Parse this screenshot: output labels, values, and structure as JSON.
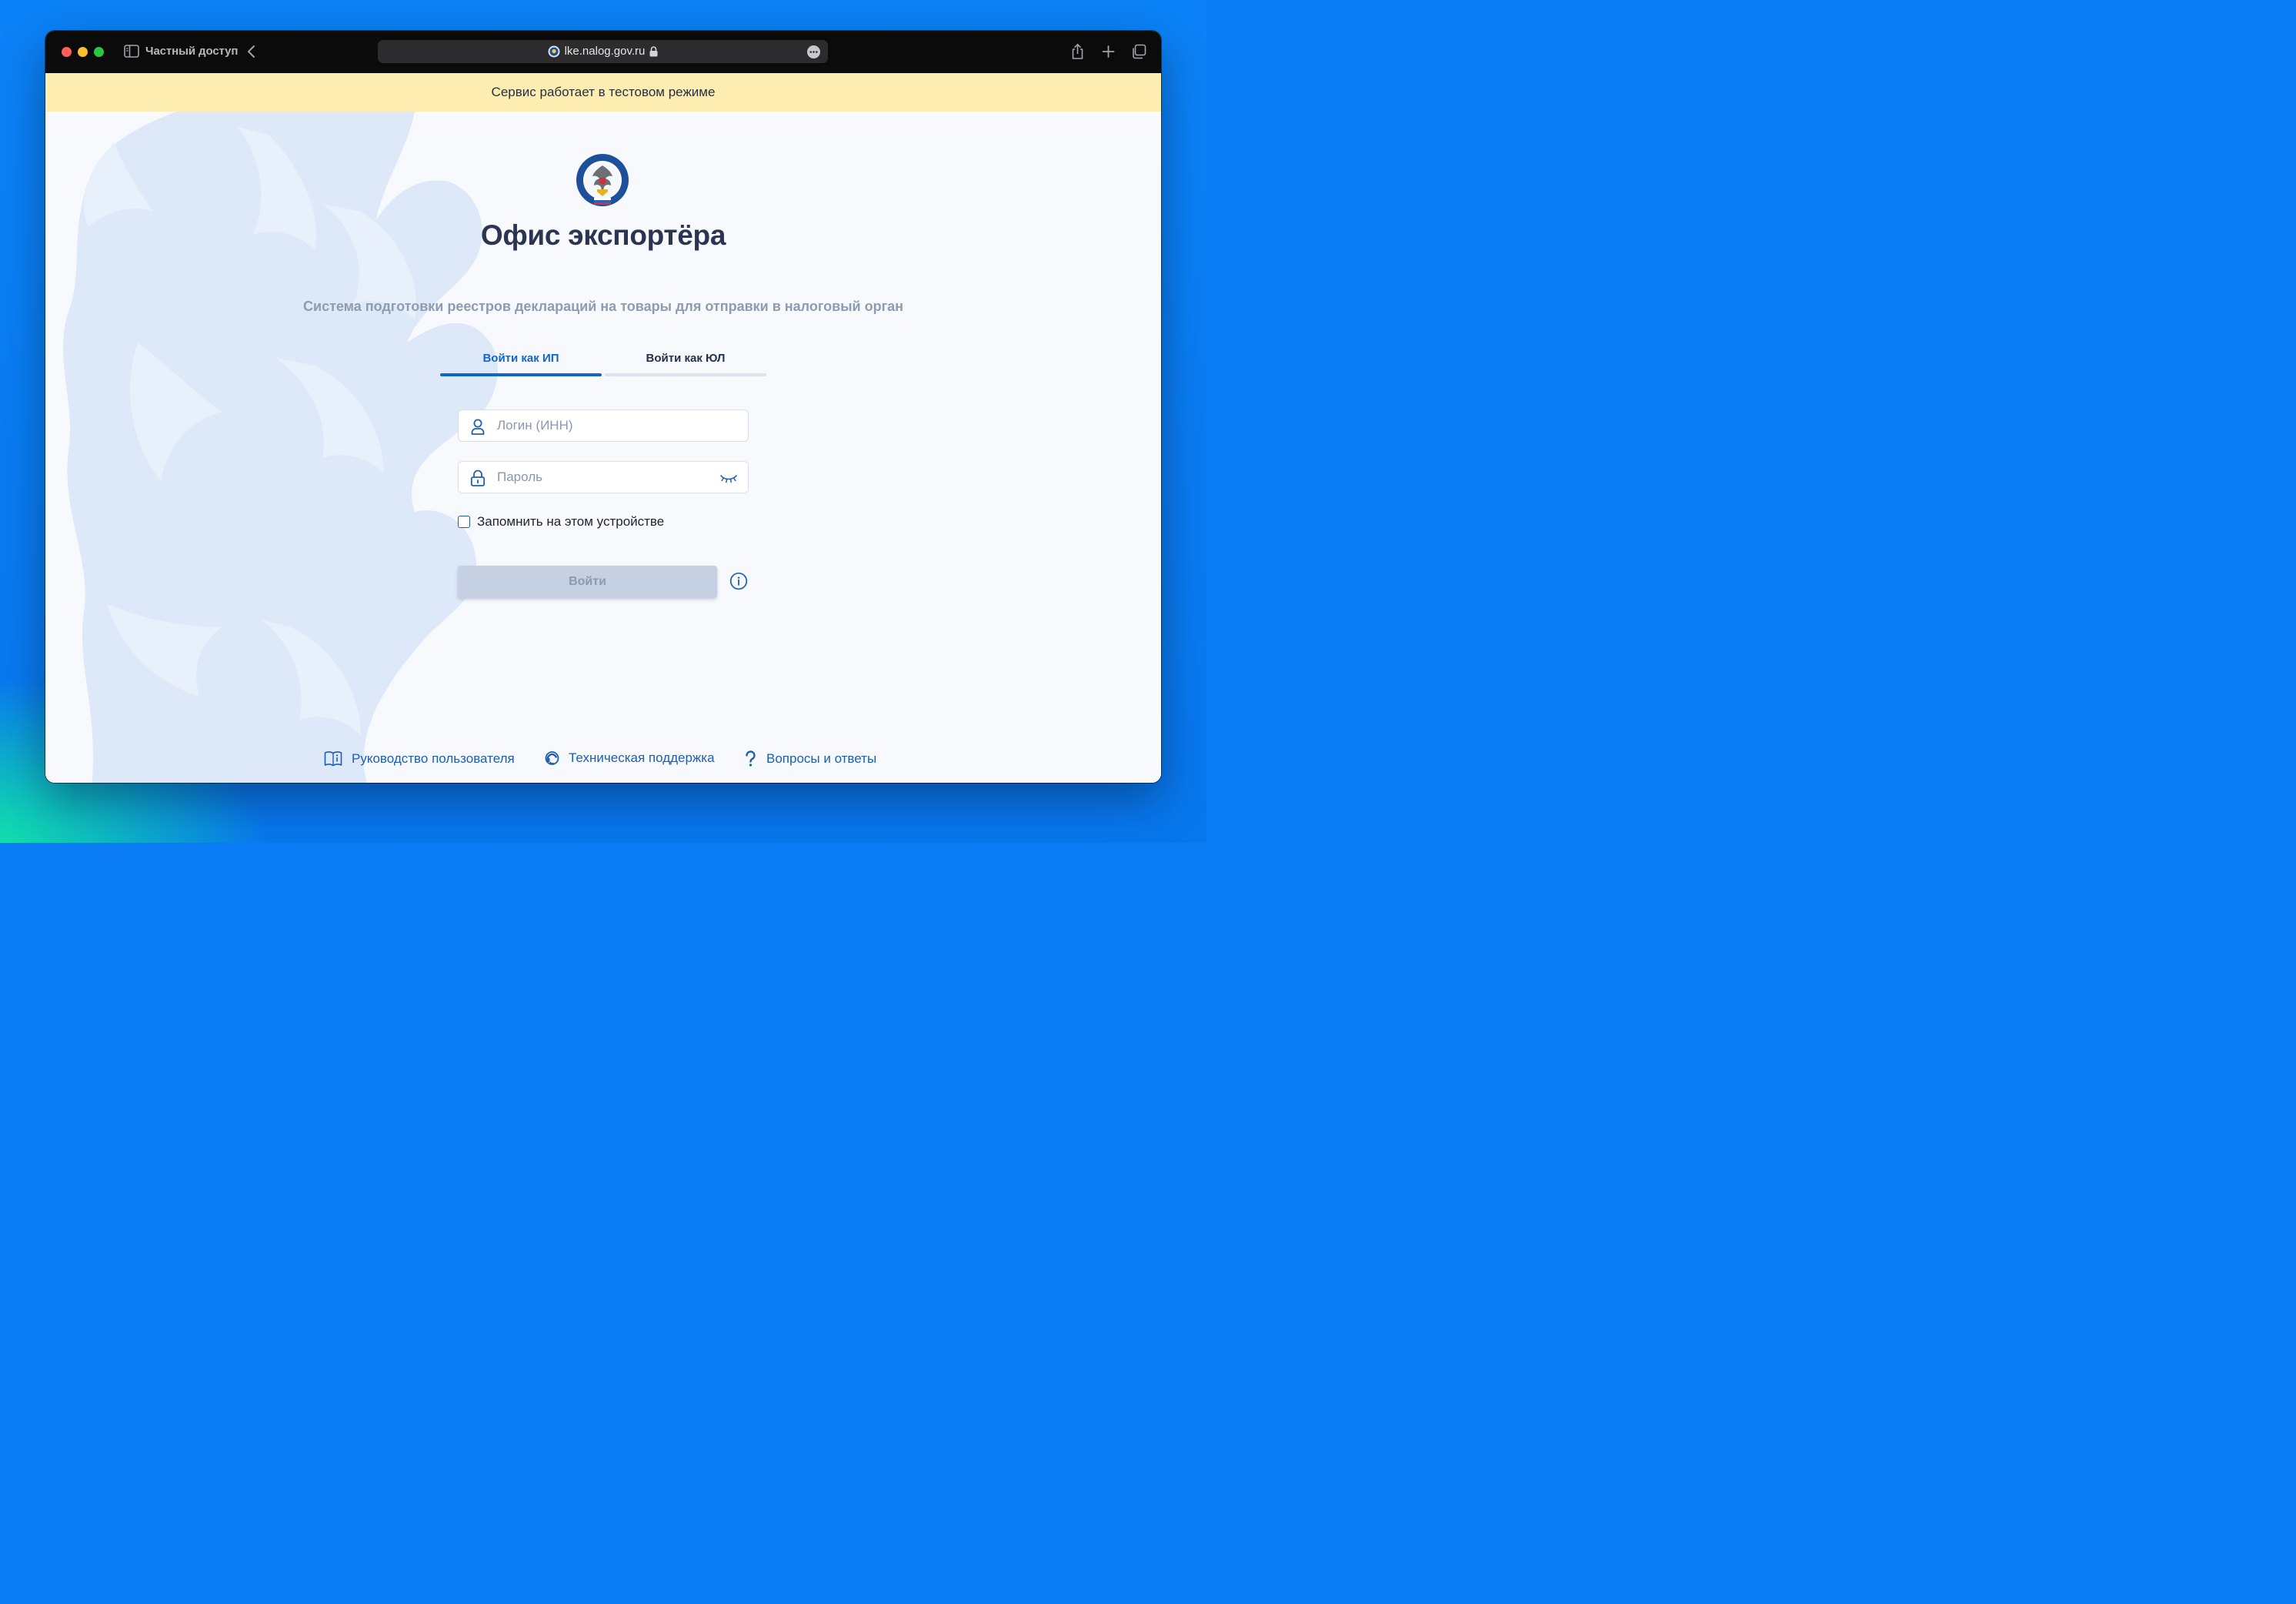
{
  "browser": {
    "private_label": "Частный доступ",
    "url": "lke.nalog.gov.ru"
  },
  "banner": {
    "text": "Сервис работает в тестовом режиме"
  },
  "header": {
    "title": "Офис экспортёра",
    "subtitle": "Система подготовки реестров деклараций на товары для отправки в налоговый орган"
  },
  "tabs": [
    {
      "label": "Войти как ИП",
      "active": true
    },
    {
      "label": "Войти как ЮЛ",
      "active": false
    }
  ],
  "form": {
    "login_placeholder": "Логин (ИНН)",
    "login_value": "",
    "password_placeholder": "Пароль",
    "password_value": "",
    "remember_label": "Запомнить на этом устройстве",
    "remember_checked": false,
    "submit_label": "Войти"
  },
  "footer": {
    "links": [
      {
        "label": "Руководство пользователя",
        "icon": "book-info-icon"
      },
      {
        "label": "Техническая поддержка",
        "icon": "headset-icon"
      },
      {
        "label": "Вопросы и ответы",
        "icon": "question-icon"
      }
    ]
  },
  "colors": {
    "accent": "#1166cc",
    "banner": "#fdedb0",
    "button_disabled": "#c5d0e2",
    "title": "#2b3450"
  }
}
